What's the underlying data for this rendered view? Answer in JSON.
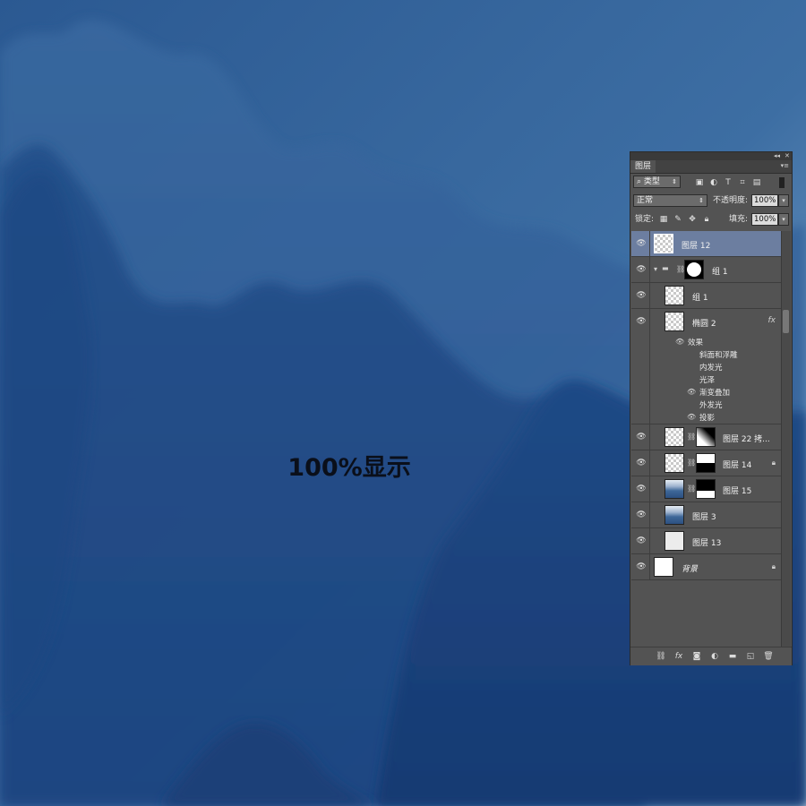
{
  "canvas": {
    "label": "100%显示",
    "colors": {
      "deep": "#1c3f74",
      "mid": "#2c5890",
      "light": "#4d7fb1",
      "sky": "#9bbad4"
    }
  },
  "panel": {
    "title_controls": {
      "collapse": "◂◂",
      "close": "✕"
    },
    "tab_label": "图层",
    "tab_menu": "▾≡",
    "filter": {
      "kind_label": "类型",
      "icons": [
        "image-filter-icon",
        "adjustment-filter-icon",
        "type-filter-icon",
        "shape-filter-icon",
        "smart-object-filter-icon"
      ]
    },
    "blend_mode": "正常",
    "opacity_label": "不透明度:",
    "opacity_value": "100%",
    "lock_label": "锁定:",
    "fill_label": "填充:",
    "fill_value": "100%",
    "selected_color": "#6c7ea0",
    "layers": [
      {
        "name": "图层 12",
        "selected": true
      },
      {
        "name": "组 1"
      },
      {
        "name": "组 1"
      },
      {
        "name": "椭圆 2",
        "fx": "fx"
      },
      {
        "name": "图层 22 拷..."
      },
      {
        "name": "图层 14"
      },
      {
        "name": "图层 15"
      },
      {
        "name": "图层 3"
      },
      {
        "name": "图层 13"
      },
      {
        "name": "背景"
      }
    ],
    "effects": {
      "header": "效果",
      "items": [
        "斜面和浮雕",
        "内发光",
        "光泽",
        "渐变叠加",
        "外发光",
        "投影"
      ]
    },
    "bottom_icons": [
      "link-layers-icon",
      "fx-icon",
      "mask-icon",
      "adjustment-icon",
      "group-folder-icon",
      "new-layer-icon",
      "trash-icon"
    ]
  }
}
